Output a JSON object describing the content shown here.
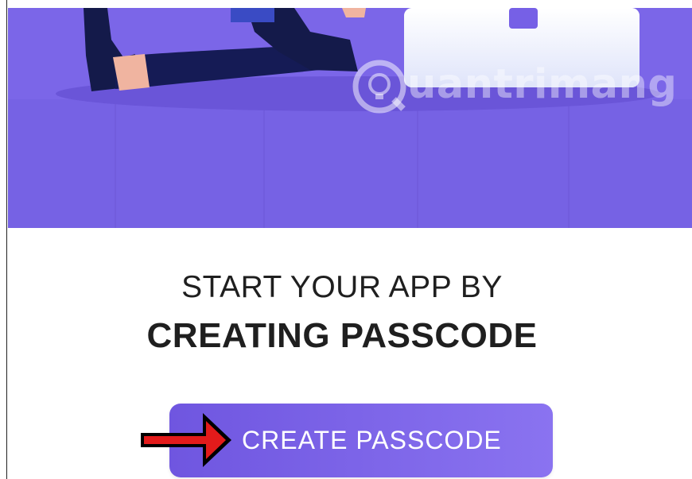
{
  "header": {
    "illustration": "person-stretching-with-laptop-illustration",
    "watermark_text": "uantrimang",
    "watermark_logo": "bulb-q-logo"
  },
  "main": {
    "headline_line1": "START YOUR APP BY",
    "headline_line2": "CREATING PASSCODE",
    "cta_label": "CREATE PASSCODE",
    "annotation": "red-arrow-pointing-right"
  },
  "colors": {
    "hero_bg": "#7b66e8",
    "button_start": "#6f56e0",
    "button_end": "#8a73f0",
    "text": "#1f1f1f",
    "arrow": "#e31b1b"
  }
}
